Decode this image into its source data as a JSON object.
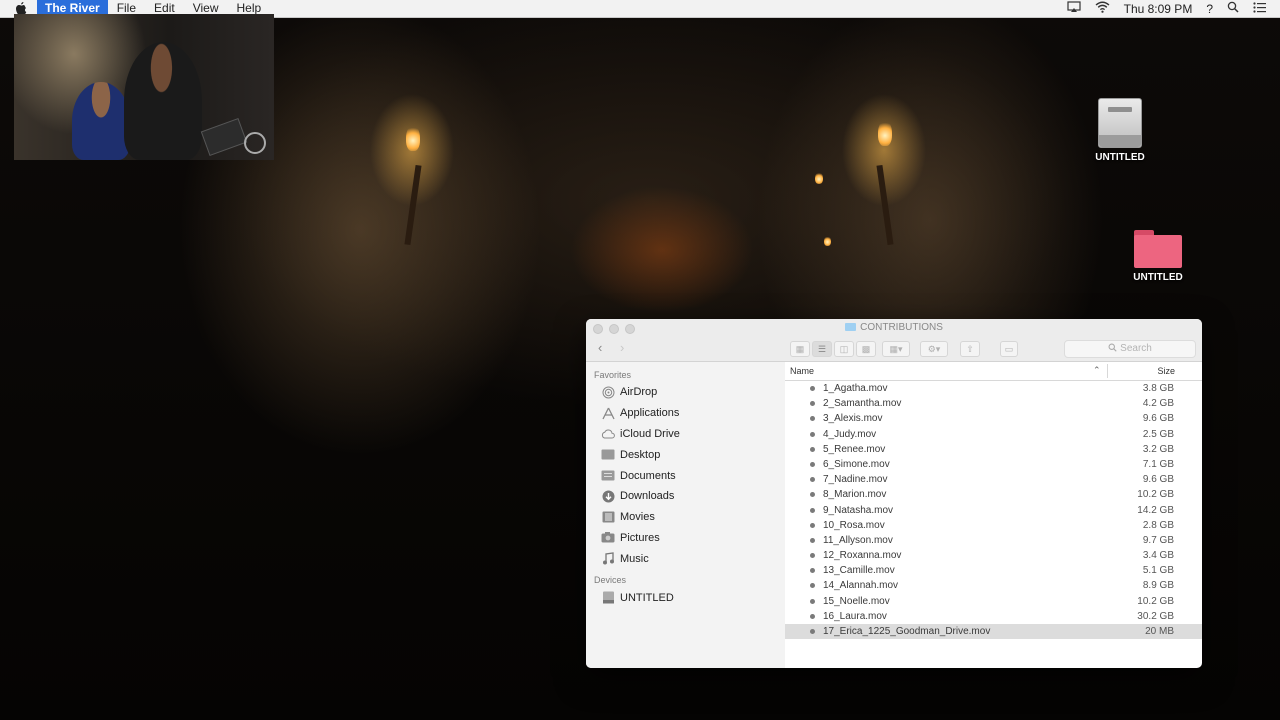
{
  "menubar": {
    "app_name": "The River",
    "menus": [
      "File",
      "Edit",
      "View",
      "Help"
    ],
    "clock": "Thu 8:09 PM",
    "help_symbol": "?"
  },
  "desktop": {
    "icons": [
      {
        "label": "UNTITLED",
        "icon": "drive-icon"
      },
      {
        "label": "UNTITLED",
        "icon": "folder-icon",
        "color": "#e8607a"
      }
    ]
  },
  "finder": {
    "title": "CONTRIBUTIONS",
    "search_placeholder": "Search",
    "sidebar": {
      "favorites_heading": "Favorites",
      "favorites": [
        {
          "label": "AirDrop",
          "icon": "airdrop-icon"
        },
        {
          "label": "Applications",
          "icon": "applications-icon"
        },
        {
          "label": "iCloud Drive",
          "icon": "cloud-icon"
        },
        {
          "label": "Desktop",
          "icon": "desktop-icon"
        },
        {
          "label": "Documents",
          "icon": "documents-icon"
        },
        {
          "label": "Downloads",
          "icon": "downloads-icon"
        },
        {
          "label": "Movies",
          "icon": "movies-icon"
        },
        {
          "label": "Pictures",
          "icon": "pictures-icon"
        },
        {
          "label": "Music",
          "icon": "music-icon"
        }
      ],
      "devices_heading": "Devices",
      "devices": [
        {
          "label": "UNTITLED",
          "icon": "drive-icon"
        }
      ]
    },
    "columns": {
      "name": "Name",
      "size": "Size"
    },
    "files": [
      {
        "name": "1_Agatha.mov",
        "size": "3.8 GB"
      },
      {
        "name": "2_Samantha.mov",
        "size": "4.2 GB"
      },
      {
        "name": "3_Alexis.mov",
        "size": "9.6 GB"
      },
      {
        "name": "4_Judy.mov",
        "size": "2.5 GB"
      },
      {
        "name": "5_Renee.mov",
        "size": "3.2 GB"
      },
      {
        "name": "6_Simone.mov",
        "size": "7.1 GB"
      },
      {
        "name": "7_Nadine.mov",
        "size": "9.6 GB"
      },
      {
        "name": "8_Marion.mov",
        "size": "10.2 GB"
      },
      {
        "name": "9_Natasha.mov",
        "size": "14.2 GB"
      },
      {
        "name": "10_Rosa.mov",
        "size": "2.8 GB"
      },
      {
        "name": "11_Allyson.mov",
        "size": "9.7 GB"
      },
      {
        "name": "12_Roxanna.mov",
        "size": "3.4 GB"
      },
      {
        "name": "13_Camille.mov",
        "size": "5.1 GB"
      },
      {
        "name": "14_Alannah.mov",
        "size": "8.9 GB"
      },
      {
        "name": "15_Noelle.mov",
        "size": "10.2 GB"
      },
      {
        "name": "16_Laura.mov",
        "size": "30.2 GB"
      },
      {
        "name": "17_Erica_1225_Goodman_Drive.mov",
        "size": "20 MB",
        "selected": true
      }
    ]
  }
}
